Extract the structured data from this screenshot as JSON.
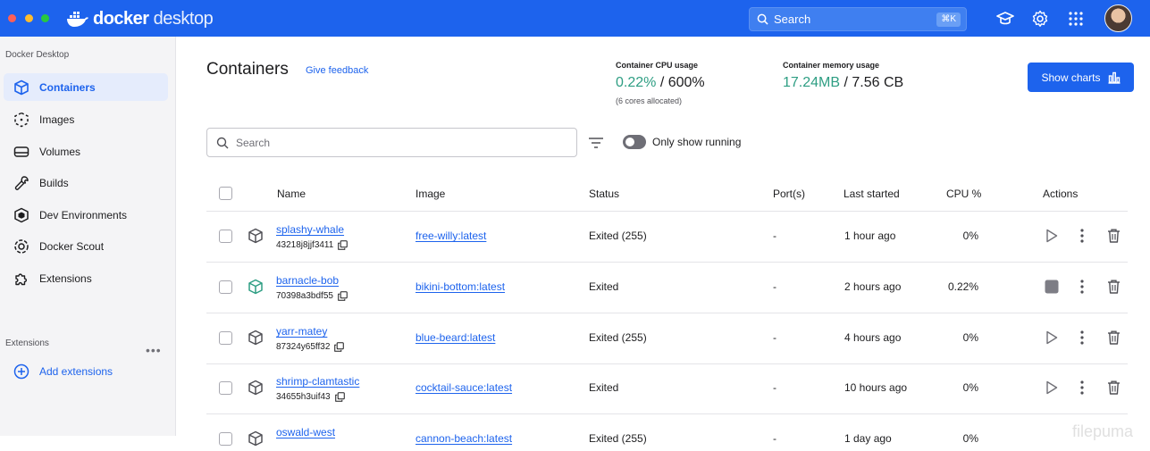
{
  "topbar": {
    "logo_bold": "docker",
    "logo_light": " desktop",
    "search_label": "Search",
    "search_shortcut": "⌘K"
  },
  "sidebar": {
    "heading": "Docker Desktop",
    "items": [
      {
        "label": "Containers",
        "icon": "container-icon",
        "active": true
      },
      {
        "label": "Images",
        "icon": "images-icon"
      },
      {
        "label": "Volumes",
        "icon": "volumes-icon"
      },
      {
        "label": "Builds",
        "icon": "builds-icon"
      },
      {
        "label": "Dev Environments",
        "icon": "dev-environments-icon"
      },
      {
        "label": "Docker Scout",
        "icon": "docker-scout-icon"
      },
      {
        "label": "Extensions",
        "icon": "extensions-icon"
      }
    ],
    "extensions_heading": "Extensions",
    "extensions_more": "•••",
    "add_extensions": "Add extensions"
  },
  "main": {
    "title": "Containers",
    "feedback": "Give feedback",
    "cpu": {
      "label": "Container CPU usage",
      "value": "0.22%",
      "total": " / 600%",
      "note": "(6 cores allocated)"
    },
    "memory": {
      "label": "Container memory usage",
      "value": "17.24MB",
      "total": " / 7.56 CB"
    },
    "show_charts": "Show charts",
    "search_placeholder": "Search",
    "only_running": "Only show running"
  },
  "table": {
    "headers": {
      "name": "Name",
      "image": "Image",
      "status": "Status",
      "ports": "Port(s)",
      "last_started": "Last started",
      "cpu": "CPU %",
      "actions": "Actions"
    },
    "rows": [
      {
        "name": "splashy-whale",
        "id": "43218j8jjf3411",
        "image": "free-willy:latest",
        "status": "Exited (255)",
        "ports": "-",
        "last_started": "1 hour ago",
        "cpu": "0%",
        "running": false
      },
      {
        "name": "barnacle-bob",
        "id": "70398a3bdf55",
        "image": "bikini-bottom:latest",
        "status": "Exited",
        "ports": "-",
        "last_started": "2 hours ago",
        "cpu": "0.22%",
        "running": true
      },
      {
        "name": "yarr-matey",
        "id": "87324y65ff32",
        "image": "blue-beard:latest",
        "status": "Exited (255)",
        "ports": "-",
        "last_started": "4 hours ago",
        "cpu": "0%",
        "running": false
      },
      {
        "name": "shrimp-clamtastic",
        "id": "34655h3uif43",
        "image": "cocktail-sauce:latest",
        "status": "Exited",
        "ports": "-",
        "last_started": "10 hours ago",
        "cpu": "0%",
        "running": false
      },
      {
        "name": "oswald-west",
        "id": "",
        "image": "cannon-beach:latest",
        "status": "Exited (255)",
        "ports": "-",
        "last_started": "1 day ago",
        "cpu": "0%",
        "running": false
      }
    ]
  },
  "watermark": "filepuma",
  "colors": {
    "brand_blue": "#1d63ed",
    "running_green": "#2e9e83"
  }
}
